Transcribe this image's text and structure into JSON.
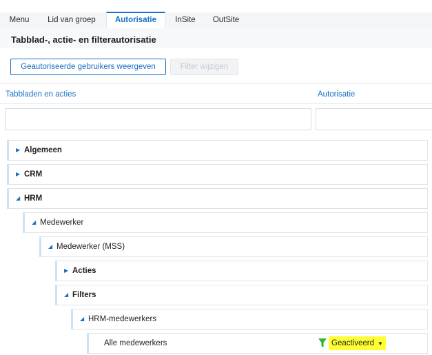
{
  "tabs": [
    {
      "label": "Menu"
    },
    {
      "label": "Lid van groep"
    },
    {
      "label": "Autorisatie"
    },
    {
      "label": "InSite"
    },
    {
      "label": "OutSite"
    }
  ],
  "active_tab": "Autorisatie",
  "page": {
    "title": "Tabblad-, actie- en filterautorisatie"
  },
  "toolbar": {
    "show_users_label": "Geautoriseerde gebruikers weergeven",
    "edit_filter_label": "Filter wijzigen"
  },
  "columns": {
    "tabs_actions": "Tabbladen en acties",
    "authorization": "Autorisatie"
  },
  "tree": [
    {
      "label": "Algemeen",
      "expanded": false
    },
    {
      "label": "CRM",
      "expanded": false
    },
    {
      "label": "HRM",
      "expanded": true
    },
    {
      "label": "Medewerker",
      "expanded": true
    },
    {
      "label": "Medewerker (MSS)",
      "expanded": true
    },
    {
      "label": "Acties",
      "expanded": false
    },
    {
      "label": "Filters",
      "expanded": true
    },
    {
      "label": "HRM-medewerkers",
      "expanded": true
    },
    {
      "label": "Alle medewerkers",
      "status": "Geactiveerd"
    }
  ],
  "colors": {
    "accent": "#1a6fc4",
    "filter_icon": "#2db52d",
    "highlight": "#ffff33"
  }
}
